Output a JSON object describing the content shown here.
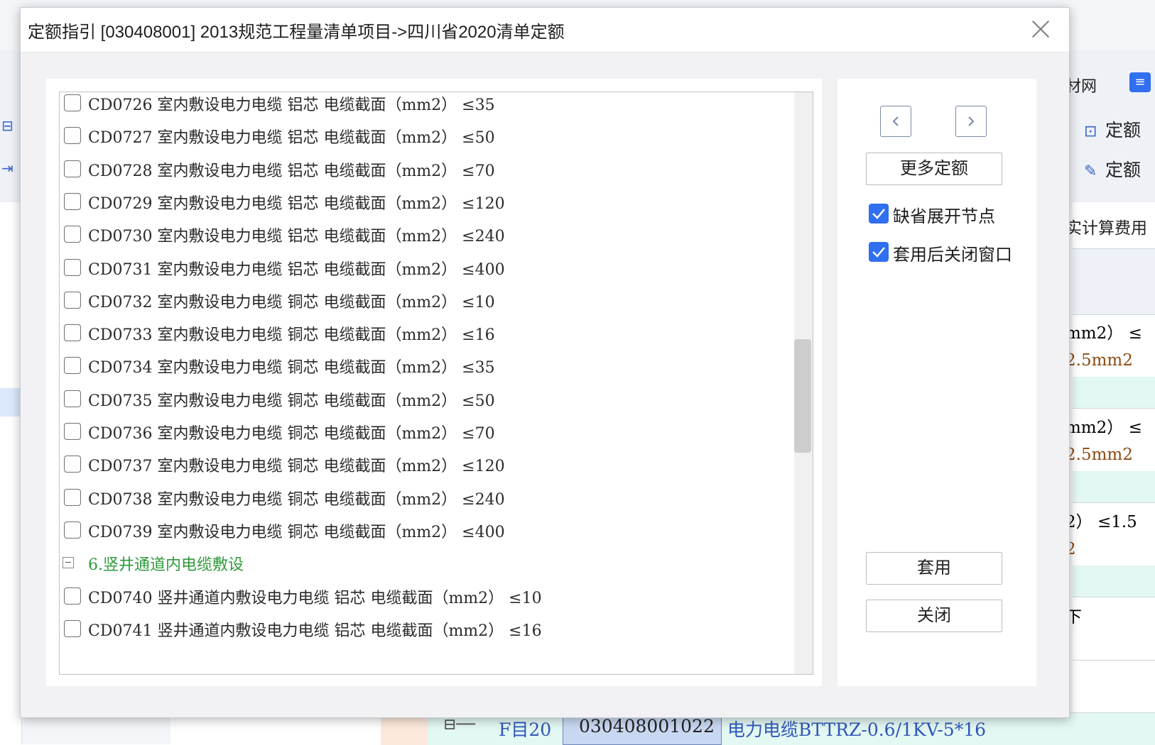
{
  "background": {
    "toolbar_item_1": "材网",
    "toolbar_item_2": "定额",
    "toolbar_item_3": "定额",
    "fee_label": "实计算费用",
    "cells": [
      {
        "text": "mm2） ≤",
        "color": "#222222"
      },
      {
        "text": "2.5mm2",
        "color": "#8a4a12"
      },
      {
        "text": "mm2） ≤",
        "color": "#222222"
      },
      {
        "text": "2.5mm2",
        "color": "#8a4a12"
      },
      {
        "text": "2） ≤1.5",
        "color": "#222222"
      },
      {
        "text": "2",
        "color": "#8a4a12"
      },
      {
        "text": "下",
        "color": "#222222"
      }
    ],
    "bottom_row": {
      "code_label": "F目20",
      "list_code": "030408001022",
      "description": "电力电缆BTTRZ-0.6/1KV-5*16"
    }
  },
  "dialog": {
    "title": "定额指引 [030408001] 2013规范工程量清单项目->四川省2020清单定额",
    "close_icon": "close-icon",
    "list_items": [
      {
        "type": "item",
        "text": "CD0726 室内敷设电力电缆 铝芯 电缆截面（mm2） ≤35",
        "checked": false
      },
      {
        "type": "item",
        "text": "CD0727 室内敷设电力电缆 铝芯 电缆截面（mm2） ≤50",
        "checked": false
      },
      {
        "type": "item",
        "text": "CD0728 室内敷设电力电缆 铝芯 电缆截面（mm2） ≤70",
        "checked": false
      },
      {
        "type": "item",
        "text": "CD0729 室内敷设电力电缆 铝芯 电缆截面（mm2） ≤120",
        "checked": false
      },
      {
        "type": "item",
        "text": "CD0730 室内敷设电力电缆 铝芯 电缆截面（mm2） ≤240",
        "checked": false
      },
      {
        "type": "item",
        "text": "CD0731 室内敷设电力电缆 铝芯 电缆截面（mm2） ≤400",
        "checked": false
      },
      {
        "type": "item",
        "text": "CD0732 室内敷设电力电缆 铜芯 电缆截面（mm2） ≤10",
        "checked": false
      },
      {
        "type": "item",
        "text": "CD0733 室内敷设电力电缆 铜芯 电缆截面（mm2） ≤16",
        "checked": false
      },
      {
        "type": "item",
        "text": "CD0734 室内敷设电力电缆 铜芯 电缆截面（mm2） ≤35",
        "checked": false
      },
      {
        "type": "item",
        "text": "CD0735 室内敷设电力电缆 铜芯 电缆截面（mm2） ≤50",
        "checked": false
      },
      {
        "type": "item",
        "text": "CD0736 室内敷设电力电缆 铜芯 电缆截面（mm2） ≤70",
        "checked": false
      },
      {
        "type": "item",
        "text": "CD0737 室内敷设电力电缆 铜芯 电缆截面（mm2） ≤120",
        "checked": false
      },
      {
        "type": "item",
        "text": "CD0738 室内敷设电力电缆 铜芯 电缆截面（mm2） ≤240",
        "checked": false
      },
      {
        "type": "item",
        "text": "CD0739 室内敷设电力电缆 铜芯 电缆截面（mm2） ≤400",
        "checked": false
      },
      {
        "type": "group",
        "text": "6.竖井通道内电缆敷设",
        "expanded": true
      },
      {
        "type": "item",
        "text": "CD0740 竖井通道内敷设电力电缆 铝芯 电缆截面（mm2） ≤10",
        "checked": false
      },
      {
        "type": "item",
        "text": "CD0741 竖井通道内敷设电力电缆 铝芯 电缆截面（mm2） ≤16",
        "checked": false
      }
    ],
    "right_panel": {
      "prev_icon": "chevron-left-icon",
      "next_icon": "chevron-right-icon",
      "more_button": "更多定额",
      "option_expand_default": {
        "label": "缺省展开节点",
        "checked": true
      },
      "option_close_after_apply": {
        "label": "套用后关闭窗口",
        "checked": true
      },
      "apply_button": "套用",
      "close_button": "关闭"
    },
    "accent_color": "#2f6ff0",
    "group_color": "#2e9a3a"
  }
}
